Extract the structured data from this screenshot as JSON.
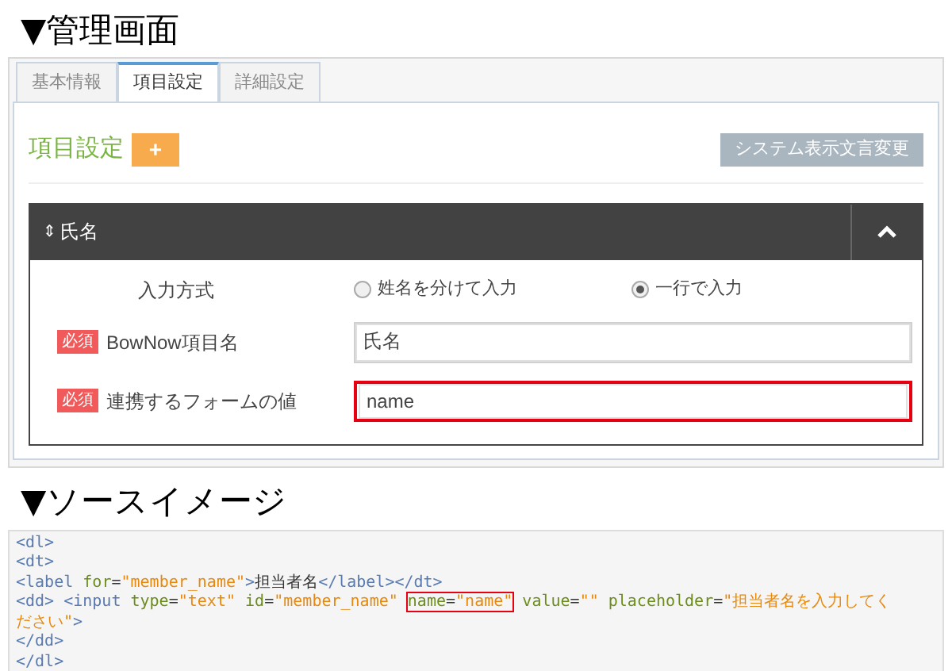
{
  "admin_heading": "▼管理画面",
  "tabs": [
    {
      "label": "基本情報",
      "selected": false
    },
    {
      "label": "項目設定",
      "selected": true
    },
    {
      "label": "詳細設定",
      "selected": false
    }
  ],
  "section": {
    "title": "項目設定",
    "add_button": "+",
    "system_button": "システム表示文言変更"
  },
  "field_panel": {
    "sort_icon": "⇕",
    "title": "氏名",
    "expanded": true,
    "rows": [
      {
        "kind": "radio",
        "label": "入力方式",
        "required": false,
        "options": [
          {
            "label": "姓名を分けて入力",
            "selected": false
          },
          {
            "label": "一行で入力",
            "selected": true
          }
        ]
      },
      {
        "kind": "text",
        "label": "BowNow項目名",
        "required": true,
        "badge": "必須",
        "value": "氏名",
        "highlighted": false
      },
      {
        "kind": "text",
        "label": "連携するフォームの値",
        "required": true,
        "badge": "必須",
        "value": "name",
        "highlighted": true
      }
    ]
  },
  "source_heading": "▼ソースイメージ",
  "code_lines": [
    [
      {
        "kind": "tag",
        "text": "<dl>"
      }
    ],
    [
      {
        "kind": "tag",
        "text": "<dt>"
      }
    ],
    [
      {
        "kind": "tag",
        "text": "<label "
      },
      {
        "kind": "attr",
        "text": "for"
      },
      {
        "kind": "plain",
        "text": "="
      },
      {
        "kind": "string",
        "text": "\"member_name\""
      },
      {
        "kind": "tag",
        "text": ">"
      },
      {
        "kind": "plain",
        "text": "担当者名"
      },
      {
        "kind": "tag",
        "text": "</label></dt>"
      }
    ],
    [
      {
        "kind": "tag",
        "text": "<dd> <input "
      },
      {
        "kind": "attr",
        "text": "type"
      },
      {
        "kind": "plain",
        "text": "="
      },
      {
        "kind": "string",
        "text": "\"text\" "
      },
      {
        "kind": "attr",
        "text": "id"
      },
      {
        "kind": "plain",
        "text": "="
      },
      {
        "kind": "string",
        "text": "\"member_name\" "
      },
      {
        "kind": "highlight",
        "tokens": [
          {
            "kind": "attr",
            "text": "name"
          },
          {
            "kind": "plain",
            "text": "="
          },
          {
            "kind": "string",
            "text": "\"name\""
          }
        ]
      },
      {
        "kind": "attr",
        "text": " value"
      },
      {
        "kind": "plain",
        "text": "="
      },
      {
        "kind": "string",
        "text": "\"\" "
      },
      {
        "kind": "attr",
        "text": "placeholder"
      },
      {
        "kind": "plain",
        "text": "="
      },
      {
        "kind": "string",
        "text": "\"担当者名を入力してく"
      }
    ],
    [
      {
        "kind": "string",
        "text": "ださい\""
      },
      {
        "kind": "tag",
        "text": ">"
      }
    ],
    [
      {
        "kind": "tag",
        "text": "</dd>"
      }
    ],
    [
      {
        "kind": "tag",
        "text": "</dl>"
      }
    ]
  ]
}
